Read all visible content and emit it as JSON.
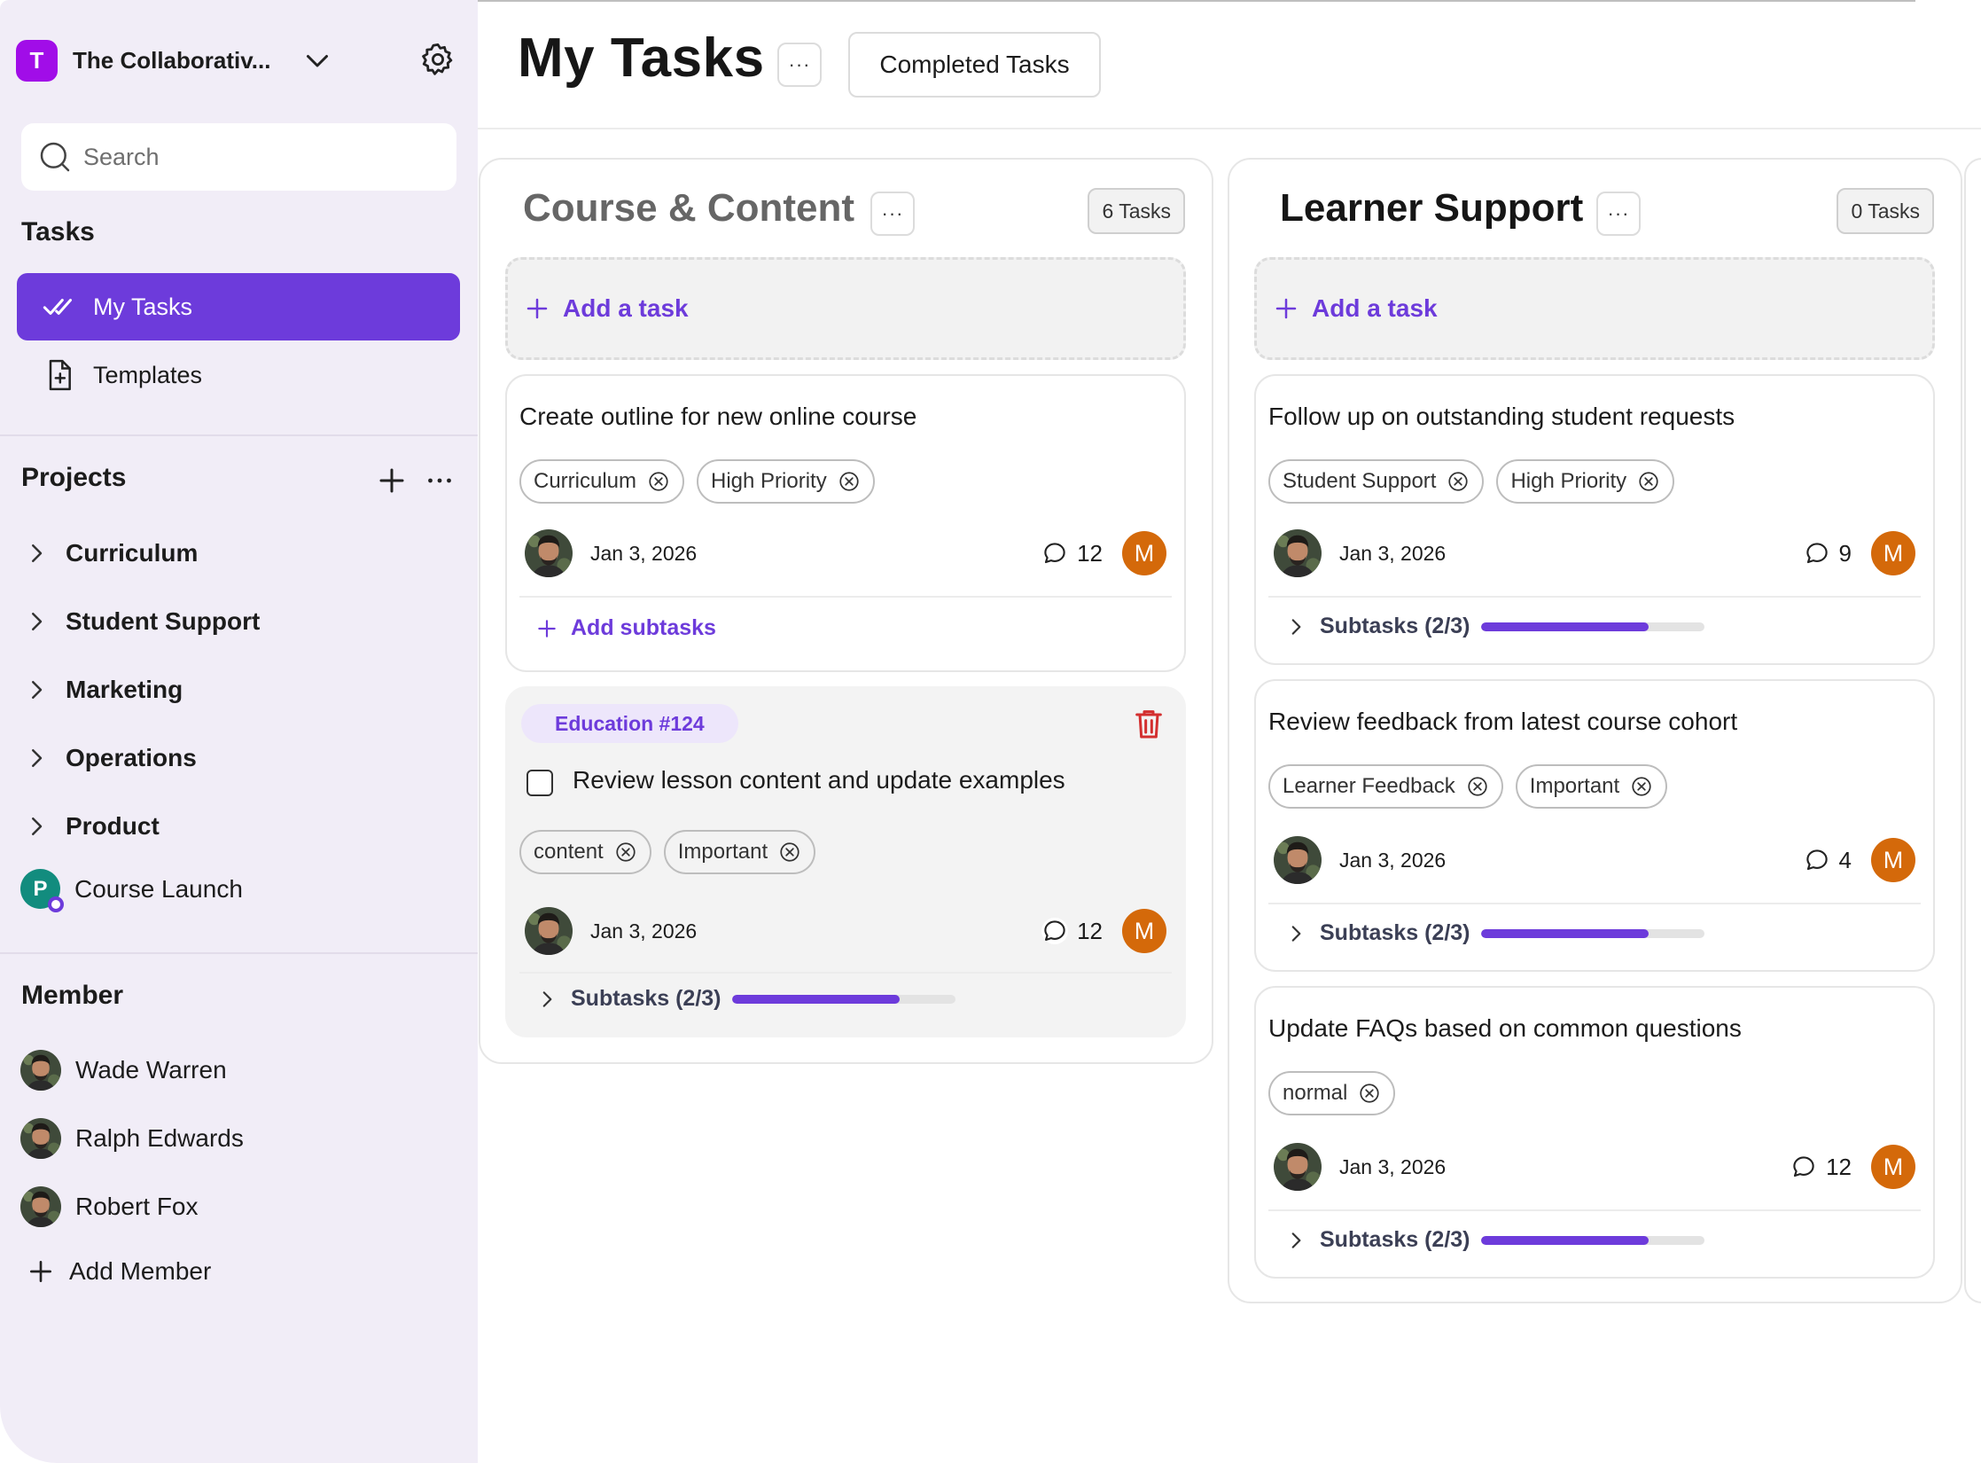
{
  "sidebar": {
    "workspace": {
      "badge": "T",
      "name": "The Collaborativ...",
      "badge_color": "#a10de8"
    },
    "search": {
      "placeholder": "Search",
      "value": ""
    },
    "tasks_section": {
      "title": "Tasks",
      "items": [
        {
          "label": "My Tasks",
          "icon": "double-check-icon",
          "active": true
        },
        {
          "label": "Templates",
          "icon": "file-plus-icon",
          "active": false
        }
      ]
    },
    "projects_section": {
      "title": "Projects",
      "items": [
        {
          "label": "Curriculum"
        },
        {
          "label": "Student Support"
        },
        {
          "label": "Marketing"
        },
        {
          "label": "Operations"
        },
        {
          "label": "Product"
        }
      ],
      "launch": {
        "badge": "P",
        "label": "Course Launch"
      }
    },
    "member_section": {
      "title": "Member",
      "members": [
        {
          "name": "Wade Warren"
        },
        {
          "name": "Ralph Edwards"
        },
        {
          "name": "Robert Fox"
        }
      ],
      "add_label": "Add Member"
    }
  },
  "header": {
    "title": "My Tasks",
    "more": "···",
    "completed_button": "Completed Tasks"
  },
  "columns": [
    {
      "title": "Course & Content",
      "more": "···",
      "count": "6 Tasks",
      "add_task": "Add a task",
      "cards": [
        {
          "title": "Create outline for new online course",
          "tags": [
            "Curriculum",
            "High Priority"
          ],
          "date": "Jan 3, 2026",
          "comments": "12",
          "assignee": "M",
          "add_subtasks": "Add subtasks"
        },
        {
          "label": "Education #124",
          "title": "Review lesson content and update examples",
          "tags": [
            "content",
            "Important"
          ],
          "date": "Jan 3, 2026",
          "comments": "12",
          "assignee": "M",
          "subtasks": "Subtasks (2/3)",
          "progress": 0.75
        }
      ]
    },
    {
      "title": "Learner Support",
      "more": "···",
      "count": "0 Tasks",
      "add_task": "Add a task",
      "cards": [
        {
          "title": "Follow up on outstanding student requests",
          "tags": [
            "Student Support",
            "High Priority"
          ],
          "date": "Jan 3, 2026",
          "comments": "9",
          "assignee": "M",
          "subtasks": "Subtasks (2/3)",
          "progress": 0.75
        },
        {
          "title": "Review feedback from latest course cohort",
          "tags": [
            "Learner Feedback",
            "Important"
          ],
          "date": "Jan 3, 2026",
          "comments": "4",
          "assignee": "M",
          "subtasks": "Subtasks (2/3)",
          "progress": 0.75
        },
        {
          "title": "Update FAQs based on common questions",
          "tags": [
            "normal"
          ],
          "date": "Jan 3, 2026",
          "comments": "12",
          "assignee": "M",
          "subtasks": "Subtasks (2/3)",
          "progress": 0.75
        }
      ]
    }
  ],
  "colors": {
    "accent": "#6d3bdb",
    "assignee": "#d4690a",
    "sidebar_bg": "#f1edf7",
    "danger": "#d32f2f"
  }
}
